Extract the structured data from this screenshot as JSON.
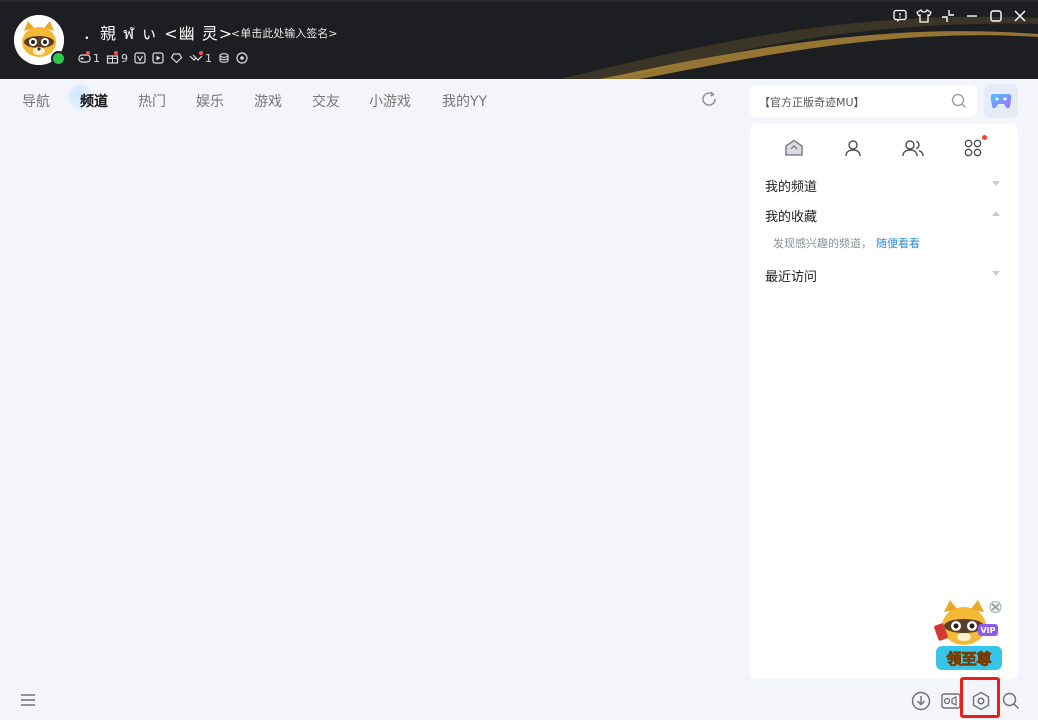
{
  "header": {
    "nickname": "．親 ฬ ぃ <幽 灵>",
    "signature": "<单击此处输入签名>",
    "stats": [
      {
        "icon": "game-controller-icon",
        "value": "1"
      },
      {
        "icon": "gift-icon",
        "value": "9"
      },
      {
        "icon": "vip-v-icon",
        "value": ""
      },
      {
        "icon": "play-icon",
        "value": ""
      },
      {
        "icon": "heart-diamond-icon",
        "value": ""
      },
      {
        "icon": "handshake-icon",
        "value": "1"
      },
      {
        "icon": "coins-icon",
        "value": ""
      },
      {
        "icon": "eye-icon",
        "value": ""
      }
    ],
    "window_controls": [
      "feedback-icon",
      "skin-shirt-icon",
      "mini-mode-icon",
      "minimize-icon",
      "maximize-icon",
      "close-icon"
    ]
  },
  "tabs": [
    {
      "label": "导航",
      "active": false
    },
    {
      "label": "频道",
      "active": true
    },
    {
      "label": "热门",
      "active": false
    },
    {
      "label": "娱乐",
      "active": false
    },
    {
      "label": "游戏",
      "active": false
    },
    {
      "label": "交友",
      "active": false
    },
    {
      "label": "小游戏",
      "active": false
    },
    {
      "label": "我的YY",
      "active": false
    }
  ],
  "search": {
    "placeholder": "【官方正版奇迹MU】"
  },
  "panel": {
    "icons": [
      "channel-home-icon",
      "person-icon",
      "friends-icon",
      "apps-grid-icon"
    ],
    "sections": {
      "my_channels": "我的频道",
      "my_favorites": "我的收藏",
      "favorites_hint": "发现感兴趣的频道，",
      "favorites_link": "随便看看",
      "recent": "最近访问"
    }
  },
  "vip_badge": {
    "text": "领至尊",
    "tag": "VIP"
  },
  "bottom_bar": [
    "menu-icon",
    "download-icon",
    "screen-record-icon",
    "settings-hex-icon",
    "search-icon"
  ],
  "colors": {
    "header_bg": "#1d1e21",
    "accent_gold": "#d9a441",
    "online": "#2fc84b",
    "link": "#2a8cd8",
    "highlight": "#e8201c"
  }
}
